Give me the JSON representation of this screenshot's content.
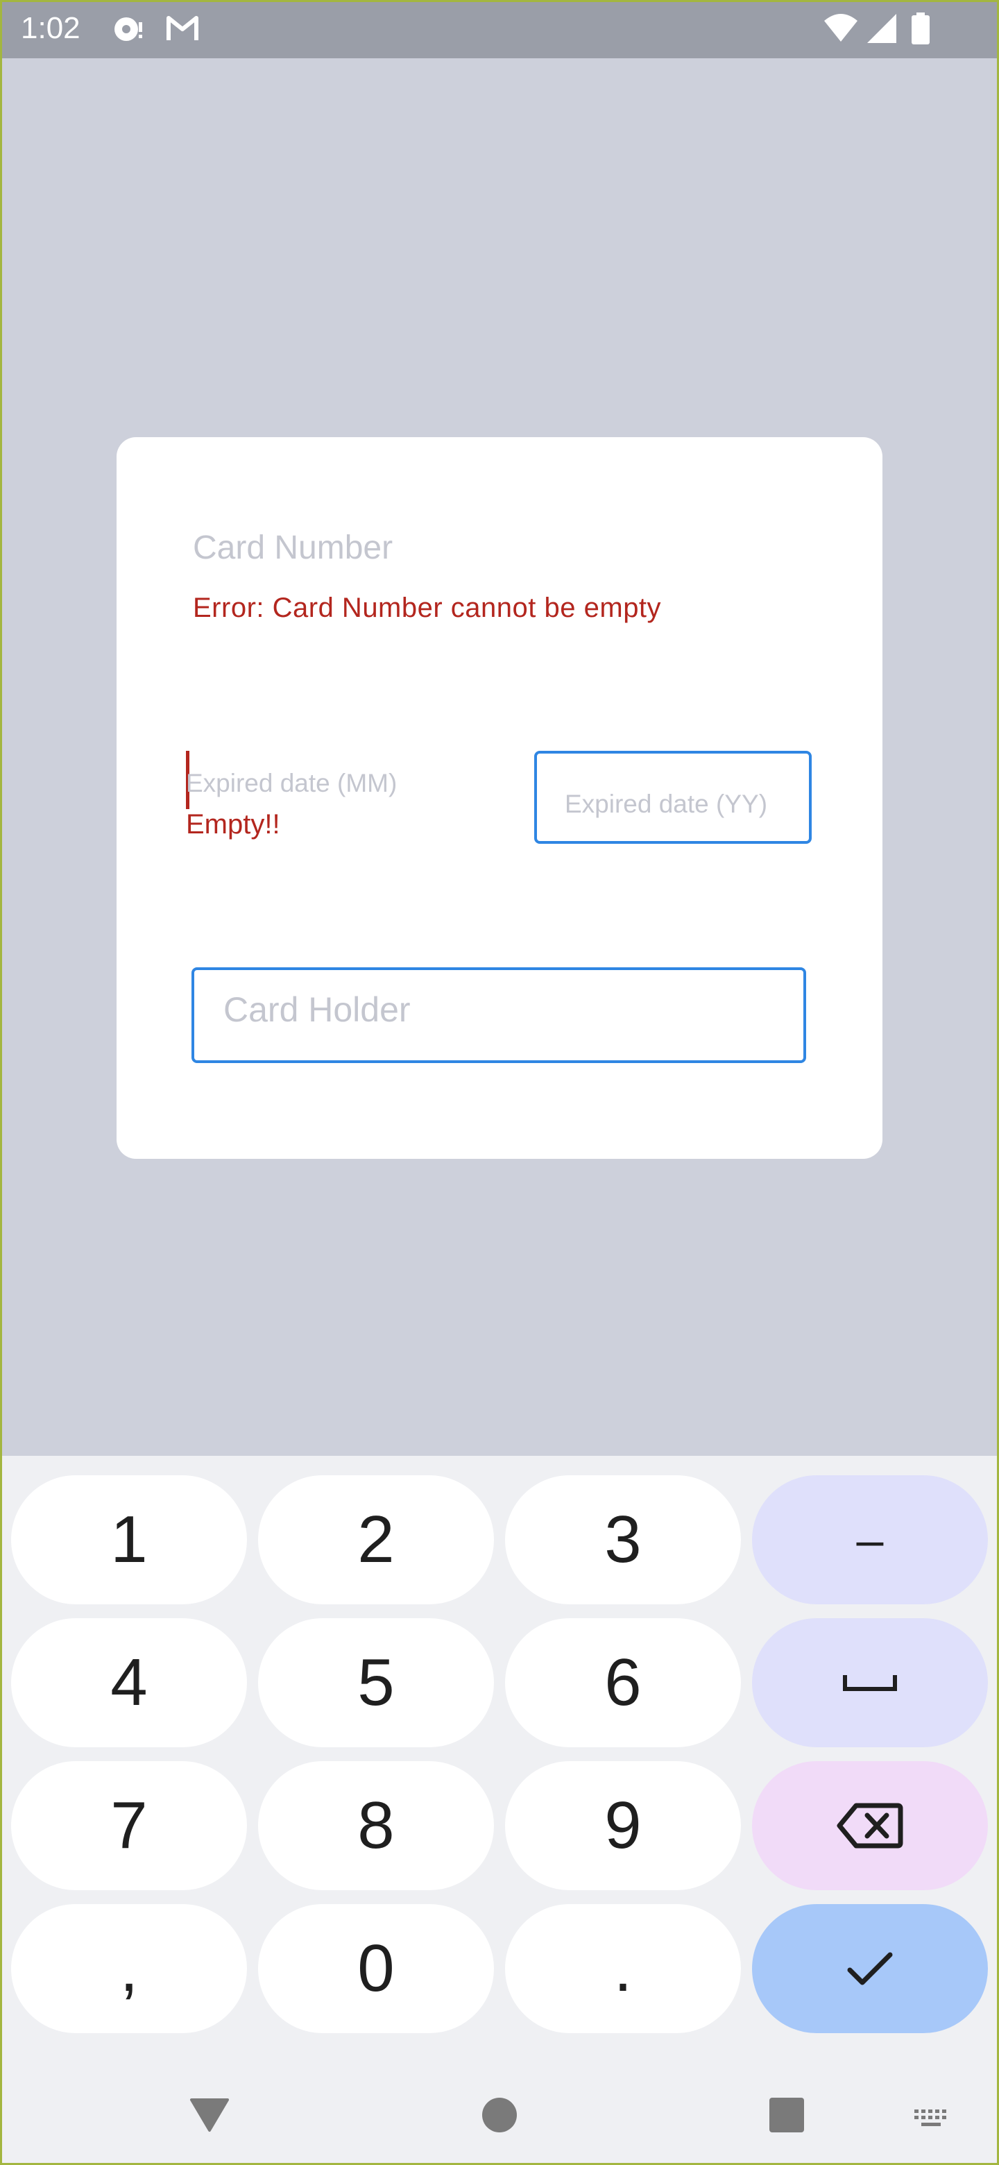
{
  "status_bar": {
    "time": "1:02",
    "icons": [
      "record-icon",
      "gmail-icon",
      "wifi-icon",
      "signal-icon",
      "battery-icon"
    ]
  },
  "form": {
    "card_number_placeholder": "Card Number",
    "card_number_error": "Error: Card Number cannot be empty",
    "exp_month_placeholder": "Expired date (MM)",
    "exp_month_error": "Empty!!",
    "exp_year_placeholder": "Expired date (YY)",
    "card_holder_placeholder": "Card Holder"
  },
  "keyboard": {
    "rows": [
      [
        "1",
        "2",
        "3",
        "–"
      ],
      [
        "4",
        "5",
        "6",
        "space"
      ],
      [
        "7",
        "8",
        "9",
        "backspace"
      ],
      [
        ",",
        "0",
        ".",
        "enter"
      ]
    ],
    "labels": {
      "k1": "1",
      "k2": "2",
      "k3": "3",
      "dash": "–",
      "k4": "4",
      "k5": "5",
      "k6": "6",
      "k7": "7",
      "k8": "8",
      "k9": "9",
      "comma": ",",
      "k0": "0",
      "period": "."
    }
  },
  "nav_bar": {
    "icons": [
      "back-icon",
      "home-icon",
      "recents-icon",
      "keyboard-switch-icon"
    ]
  },
  "colors": {
    "background": "#cdd0db",
    "error": "#b3261e",
    "accent": "#2f86e3",
    "enter_key": "#a7c8f9"
  }
}
